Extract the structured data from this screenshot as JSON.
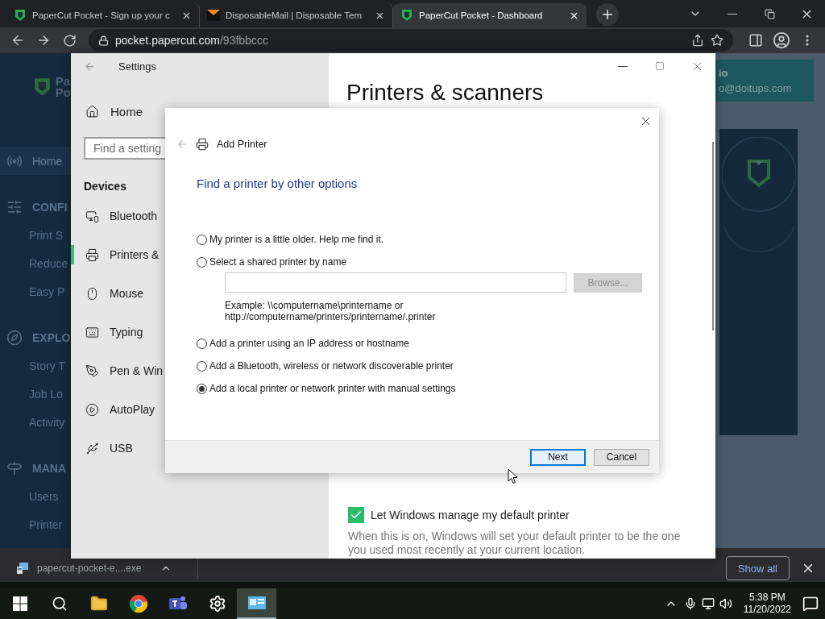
{
  "browser": {
    "tabs": [
      {
        "kind": "papercut",
        "title": "PaperCut Pocket - Sign up your c",
        "selected": false
      },
      {
        "kind": "mail",
        "title": "DisposableMail | Disposable Tem",
        "selected": false
      },
      {
        "kind": "papercut",
        "title": "PaperCut Pocket - Dashboard",
        "selected": true
      }
    ],
    "url": {
      "host": "pocket.papercut.com",
      "path": "/93fbbccc"
    }
  },
  "page": {
    "logo": [
      "Pa",
      "Po"
    ],
    "sidebar": [
      {
        "kind": "home",
        "label": "Home",
        "selected": true
      },
      {
        "kind": "config",
        "label": "CONFI",
        "selected": false
      },
      {
        "kind": "link",
        "label": "Print S",
        "selected": false
      },
      {
        "kind": "link",
        "label": "Reduce",
        "selected": false
      },
      {
        "kind": "link",
        "label": "Easy P",
        "selected": false
      },
      {
        "kind": "explore",
        "label": "EXPLO",
        "selected": false
      },
      {
        "kind": "link",
        "label": "Story T",
        "selected": false
      },
      {
        "kind": "link",
        "label": "Job Lo",
        "selected": false
      },
      {
        "kind": "link",
        "label": "Activity",
        "selected": false
      },
      {
        "kind": "manage",
        "label": "MANA",
        "selected": false
      },
      {
        "kind": "link",
        "label": "Users",
        "selected": false
      },
      {
        "kind": "link",
        "label": "Printer",
        "selected": false
      }
    ],
    "account": {
      "name": "io",
      "email": "o@doitups.com"
    }
  },
  "settings": {
    "title": "Settings",
    "home": "Home",
    "search_placeholder": "Find a setting",
    "group": "Devices",
    "items": [
      {
        "kind": "devices",
        "label": "Bluetooth",
        "selected": false
      },
      {
        "kind": "printer",
        "label": "Printers &",
        "selected": true
      },
      {
        "kind": "mouse",
        "label": "Mouse",
        "selected": false
      },
      {
        "kind": "keyboard",
        "label": "Typing",
        "selected": false
      },
      {
        "kind": "pen",
        "label": "Pen & Win",
        "selected": false
      },
      {
        "kind": "autoplay",
        "label": "AutoPlay",
        "selected": false
      },
      {
        "kind": "usb",
        "label": "USB",
        "selected": false
      }
    ],
    "heading": "Printers & scanners",
    "default_printer": {
      "label": "Let Windows manage my default printer",
      "checked": true,
      "description": "When this is on, Windows will set your default printer to be the one you used most recently at your current location."
    }
  },
  "dialog": {
    "title": "Add Printer",
    "heading": "Find a printer by other options",
    "options": [
      {
        "kind": "plain",
        "label": "My printer is a little older. Help me find it.",
        "selected": false
      },
      {
        "kind": "with_path",
        "label": "Select a shared printer by name",
        "selected": false
      },
      {
        "kind": "plain",
        "label": "Add a printer using an IP address or hostname",
        "selected": false
      },
      {
        "kind": "plain",
        "label": "Add a Bluetooth, wireless or network discoverable printer",
        "selected": false
      },
      {
        "kind": "plain",
        "label": "Add a local printer or network printer with manual settings",
        "selected": true
      }
    ],
    "browse": {
      "label": "Browse...",
      "disabled": true
    },
    "example": [
      "Example: \\\\computername\\printername or",
      "http://computername/printers/printername/.printer"
    ],
    "buttons": [
      {
        "label": "Next",
        "default": true
      },
      {
        "label": "Cancel",
        "default": false
      }
    ]
  },
  "downloads": {
    "file": "papercut-pocket-e....exe",
    "show_all": "Show all"
  },
  "taskbar": {
    "apps": [
      {
        "kind": "files",
        "active": false
      },
      {
        "kind": "chrome",
        "active": false
      },
      {
        "kind": "teams",
        "active": false
      },
      {
        "kind": "settings",
        "active": false
      },
      {
        "kind": "control",
        "active": true
      }
    ],
    "time": "5:38 PM",
    "date": "11/20/2022"
  }
}
